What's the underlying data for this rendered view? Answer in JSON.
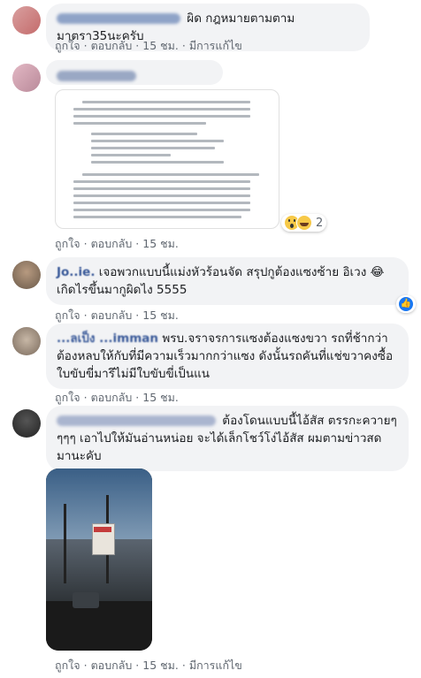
{
  "comments": [
    {
      "text": "ผิด กฎหมายตามตามมาตรา35นะครับ",
      "actions": {
        "like": "ถูกใจ",
        "reply": "ตอบกลับ",
        "time": "15 ชม.",
        "edited": "มีการแก้ไข"
      }
    },
    {
      "actions": {
        "like": "ถูกใจ",
        "reply": "ตอบกลับ",
        "time": "15 ชม."
      },
      "reaction_count": "2",
      "reaction_icons": [
        "wow-icon",
        "laugh-icon"
      ]
    },
    {
      "name": "Jo..ie.",
      "text": "เจอพวกแบบนี้แม่งหัวร้อนจัด สรุปกูต้องแซงซ้าย อิเวง 😂 เกิดไรขึ้นมากูผิดไง 5555",
      "actions": {
        "like": "ถูกใจ",
        "reply": "ตอบกลับ",
        "time": "15 ชม."
      },
      "reaction_icons": [
        "like-icon"
      ]
    },
    {
      "name": "...ลเป็ง ...imman",
      "text": "พรบ.จราจรการแซงต้องแซงขวา รถที่ช้ากว่าต้องหลบให้กับที่มีความเร็วมากกว่าแซง ดังนั้นรถคันที่แช่ขวาคงซื้อใบขับขี่มารึไม่มีใบขับขี่เป็นแน",
      "actions": {
        "like": "ถูกใจ",
        "reply": "ตอบกลับ",
        "time": "15 ชม."
      }
    },
    {
      "text": "ต้องโดนแบบนี้ไอ้สัส ตรรกะควายๆๆๆๆ เอาไปให้มันอ่านหน่อย จะได้เล็กโชว์โง่ไอ้สัส ผมตามข่าวสดมานะคับ",
      "actions": {
        "like": "ถูกใจ",
        "reply": "ตอบกลับ",
        "time": "15 ชม.",
        "edited": "มีการแก้ไข"
      }
    }
  ],
  "colors": {
    "link": "#385898",
    "bubble": "#f2f3f5",
    "meta": "#606770",
    "like": "#1877f2"
  }
}
